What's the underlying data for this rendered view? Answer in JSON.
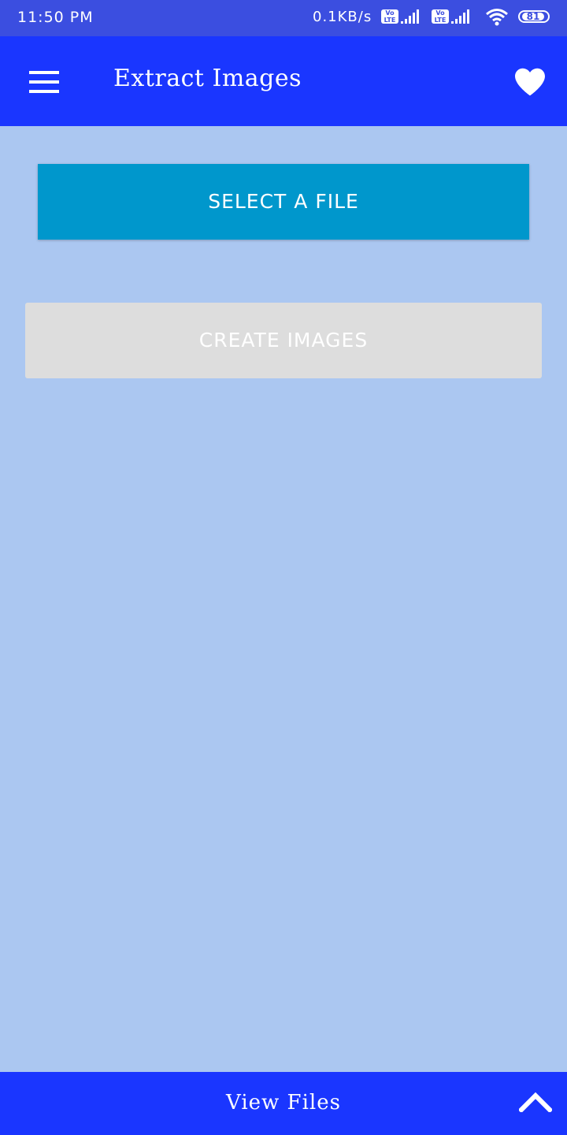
{
  "status_bar": {
    "time": "11:50 PM",
    "network_speed": "0.1KB/s",
    "volte_label": "Vo LTE",
    "battery_level": "81"
  },
  "app_bar": {
    "title": "Extract Images",
    "menu_icon": "hamburger-menu-icon",
    "favorite_icon": "heart-icon"
  },
  "main": {
    "select_button_label": "SELECT A FILE",
    "create_button_label": "CREATE IMAGES"
  },
  "bottom_bar": {
    "label": "View Files",
    "icon": "chevron-up-icon"
  },
  "colors": {
    "status_bar": "#3b4ee0",
    "app_bar": "#1a36ff",
    "background": "#abc7f1",
    "select_button": "#0097cc",
    "create_button_disabled": "#dddddd"
  }
}
